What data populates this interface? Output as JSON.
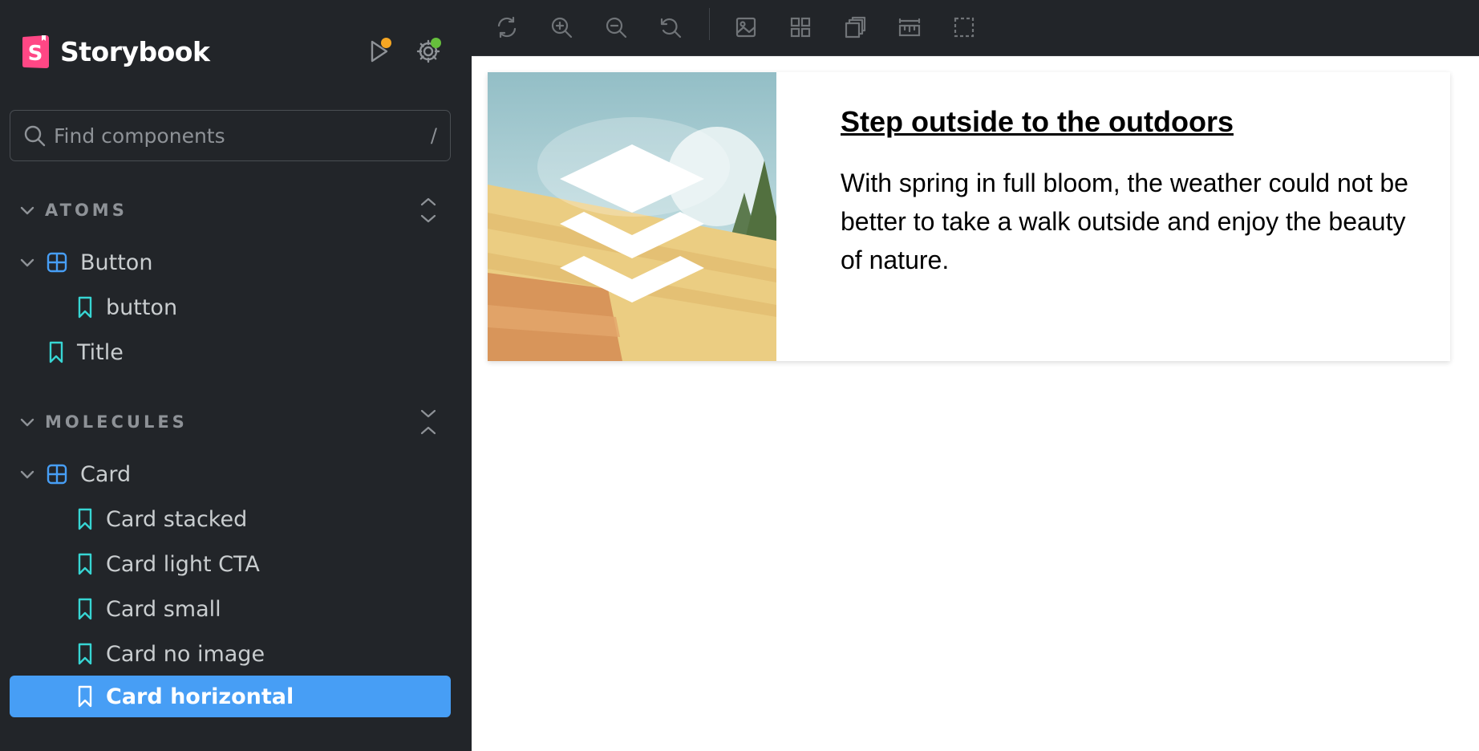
{
  "app": {
    "name": "Storybook"
  },
  "search": {
    "placeholder": "Find components",
    "shortcut": "/"
  },
  "sidebar": {
    "groups": [
      {
        "title": "ATOMS"
      },
      {
        "title": "MOLECULES"
      }
    ],
    "items": [
      {
        "label": "Button"
      },
      {
        "label": "button"
      },
      {
        "label": "Title"
      },
      {
        "label": "Card"
      },
      {
        "label": "Card stacked"
      },
      {
        "label": "Card light CTA"
      },
      {
        "label": "Card small"
      },
      {
        "label": "Card no image"
      },
      {
        "label": "Card horizontal"
      }
    ]
  },
  "toolbar": {
    "tools": [
      "remount-icon",
      "zoom-in-icon",
      "zoom-out-icon",
      "reset-zoom-icon",
      "background-icon",
      "grid-icon",
      "viewport-icon",
      "measure-icon",
      "outline-icon"
    ]
  },
  "card": {
    "title": "Step outside to the outdoors",
    "text": "With spring in full bloom, the weather could not be better to take a walk outside and enjoy the beauty of nature."
  },
  "colors": {
    "sidebar_bg": "#222529",
    "selected": "#479ef5",
    "component_icon": "#479ef5",
    "story_icon": "#37d5d3",
    "logo": "#ff4785",
    "status_orange": "#f5a623",
    "status_green": "#66bf3c"
  }
}
